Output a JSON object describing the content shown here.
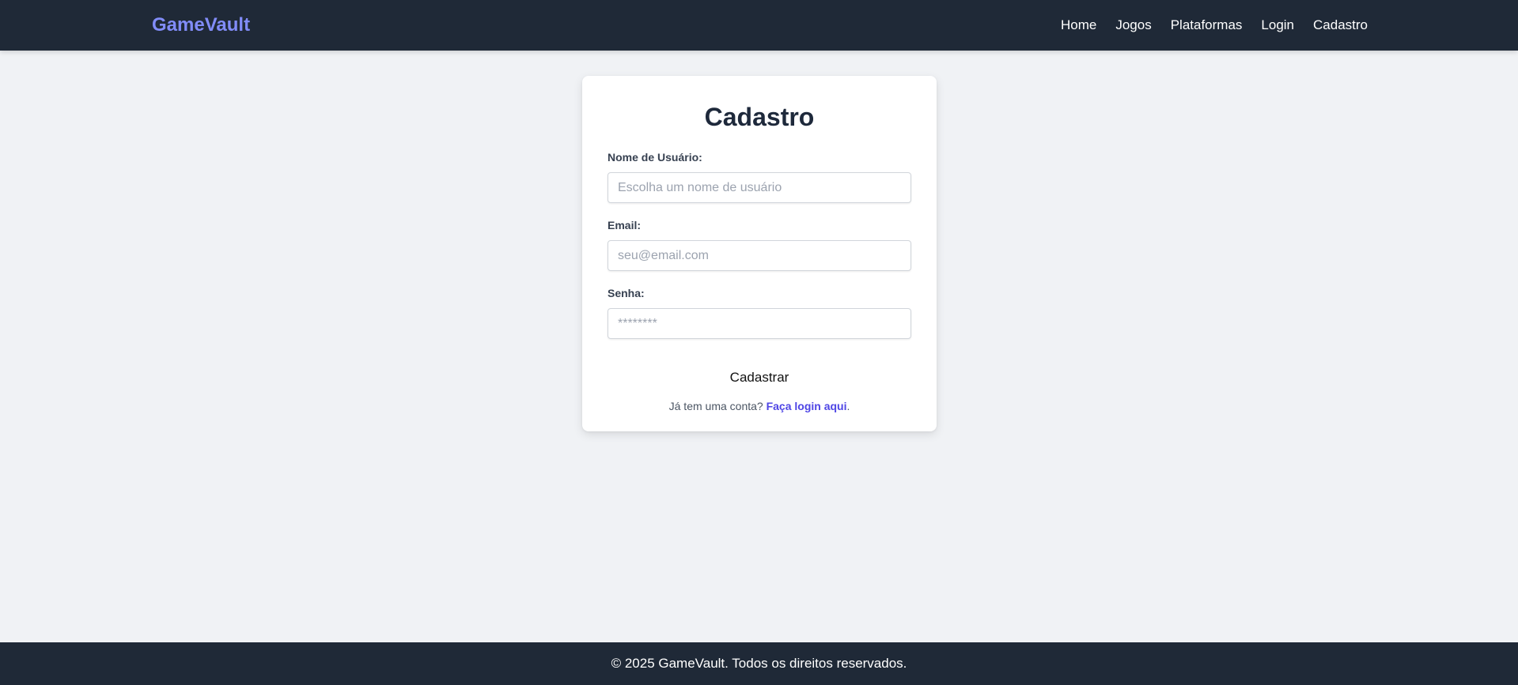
{
  "header": {
    "brand": "GameVault",
    "nav": [
      {
        "label": "Home"
      },
      {
        "label": "Jogos"
      },
      {
        "label": "Plataformas"
      },
      {
        "label": "Login"
      },
      {
        "label": "Cadastro"
      }
    ]
  },
  "form": {
    "title": "Cadastro",
    "username": {
      "label": "Nome de Usuário:",
      "placeholder": "Escolha um nome de usuário",
      "value": ""
    },
    "email": {
      "label": "Email:",
      "placeholder": "seu@email.com",
      "value": ""
    },
    "password": {
      "label": "Senha:",
      "placeholder": "********",
      "value": ""
    },
    "submit_label": "Cadastrar",
    "login_prompt": "Já tem uma conta?",
    "login_link": "Faça login aqui",
    "login_suffix": "."
  },
  "footer": {
    "text": "© 2025 GameVault. Todos os direitos reservados."
  },
  "colors": {
    "nav_bg": "#1f2937",
    "brand": "#818cf8",
    "page_bg": "#f0f2f5",
    "link": "#4f46e5"
  }
}
